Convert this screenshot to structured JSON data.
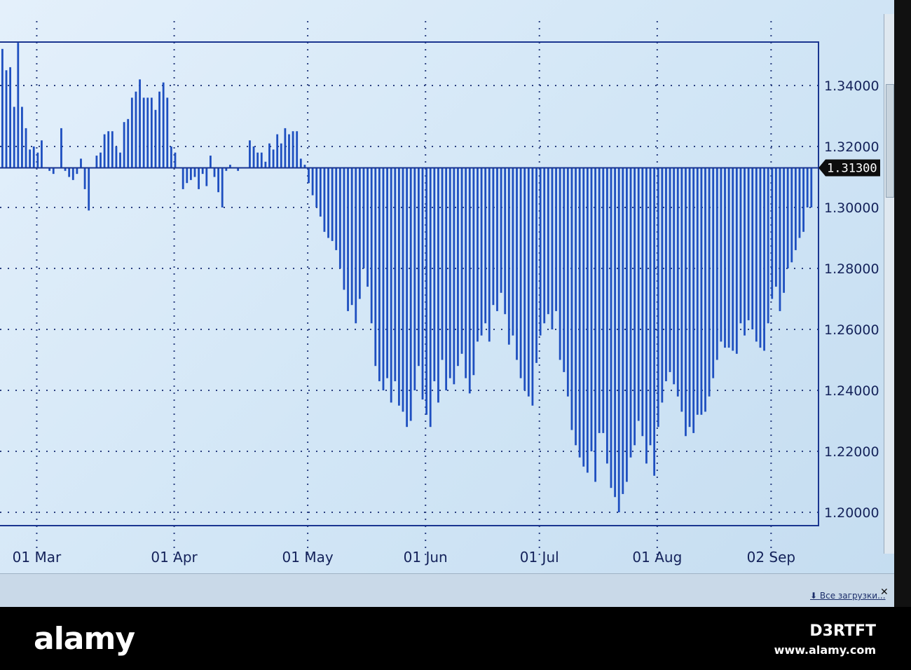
{
  "chart_data": {
    "type": "bar",
    "title": "",
    "baseline": 1.313,
    "current_price_label": "1.31300",
    "ylim": [
      1.19,
      1.355
    ],
    "yticks": [
      1.2,
      1.22,
      1.24,
      1.26,
      1.28,
      1.3,
      1.32,
      1.34
    ],
    "ytick_labels": [
      "1.20000",
      "1.22000",
      "1.24000",
      "1.26000",
      "1.28000",
      "1.30000",
      "1.32000",
      "1.34000"
    ],
    "xticks": [
      {
        "label": "01 Mar",
        "index": 9
      },
      {
        "label": "01 Apr",
        "index": 44
      },
      {
        "label": "01 May",
        "index": 78
      },
      {
        "label": "01 Jun",
        "index": 108
      },
      {
        "label": "01 Jul",
        "index": 137
      },
      {
        "label": "01 Aug",
        "index": 167
      },
      {
        "label": "02 Sep",
        "index": 196
      }
    ],
    "grid": true,
    "values": [
      1.352,
      1.345,
      1.346,
      1.333,
      1.354,
      1.333,
      1.326,
      1.319,
      1.32,
      1.318,
      1.322,
      1.313,
      1.312,
      1.311,
      1.313,
      1.326,
      1.312,
      1.31,
      1.309,
      1.311,
      1.316,
      1.306,
      1.299,
      1.313,
      1.317,
      1.318,
      1.324,
      1.325,
      1.325,
      1.32,
      1.318,
      1.328,
      1.329,
      1.336,
      1.338,
      1.342,
      1.336,
      1.336,
      1.336,
      1.332,
      1.338,
      1.341,
      1.336,
      1.32,
      1.318,
      1.313,
      1.306,
      1.308,
      1.309,
      1.31,
      1.306,
      1.311,
      1.307,
      1.317,
      1.31,
      1.305,
      1.3,
      1.312,
      1.314,
      1.313,
      1.312,
      1.313,
      1.313,
      1.322,
      1.32,
      1.318,
      1.318,
      1.315,
      1.321,
      1.319,
      1.324,
      1.321,
      1.326,
      1.324,
      1.325,
      1.325,
      1.316,
      1.314,
      1.308,
      1.304,
      1.3,
      1.297,
      1.292,
      1.29,
      1.289,
      1.286,
      1.28,
      1.273,
      1.266,
      1.268,
      1.262,
      1.27,
      1.28,
      1.274,
      1.262,
      1.248,
      1.243,
      1.24,
      1.244,
      1.236,
      1.243,
      1.235,
      1.233,
      1.228,
      1.23,
      1.24,
      1.248,
      1.237,
      1.232,
      1.228,
      1.243,
      1.236,
      1.25,
      1.24,
      1.244,
      1.242,
      1.248,
      1.252,
      1.244,
      1.239,
      1.245,
      1.256,
      1.258,
      1.262,
      1.256,
      1.268,
      1.266,
      1.272,
      1.265,
      1.255,
      1.258,
      1.25,
      1.244,
      1.24,
      1.238,
      1.235,
      1.249,
      1.258,
      1.262,
      1.265,
      1.26,
      1.266,
      1.25,
      1.246,
      1.238,
      1.227,
      1.222,
      1.218,
      1.215,
      1.213,
      1.22,
      1.21,
      1.226,
      1.226,
      1.216,
      1.208,
      1.205,
      1.2,
      1.206,
      1.21,
      1.218,
      1.222,
      1.23,
      1.225,
      1.216,
      1.222,
      1.212,
      1.228,
      1.236,
      1.243,
      1.246,
      1.242,
      1.238,
      1.233,
      1.225,
      1.228,
      1.226,
      1.232,
      1.232,
      1.233,
      1.238,
      1.244,
      1.25,
      1.256,
      1.254,
      1.254,
      1.253,
      1.252,
      1.262,
      1.258,
      1.263,
      1.26,
      1.256,
      1.254,
      1.253,
      1.262,
      1.27,
      1.274,
      1.266,
      1.272,
      1.28,
      1.282,
      1.286,
      1.29,
      1.292,
      1.3,
      1.3
    ],
    "colors": {
      "bar": "#1e4fc0",
      "axis": "#1a3590",
      "grid": "#2a3f80"
    }
  },
  "downloads_bar": {
    "link": "Все загрузки...",
    "close": "✕"
  },
  "watermark": {
    "logo": "alamy",
    "image_id": "D3RTFT",
    "site": "www.alamy.com"
  }
}
